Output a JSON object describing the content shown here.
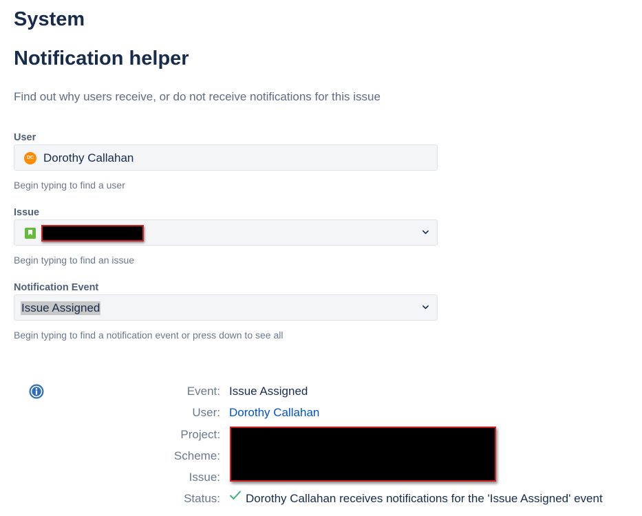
{
  "header": {
    "system_title": "System",
    "page_title": "Notification helper",
    "intro": "Find out why users receive, or do not receive notifications for this issue"
  },
  "form": {
    "user": {
      "label": "User",
      "avatar_initials": "DC",
      "value": "Dorothy Callahan",
      "hint": "Begin typing to find a user"
    },
    "issue": {
      "label": "Issue",
      "value_redacted": true,
      "hint": "Begin typing to find an issue"
    },
    "event": {
      "label": "Notification Event",
      "value": "Issue Assigned",
      "hint": "Begin typing to find a notification event or press down to see all"
    }
  },
  "result": {
    "event_label": "Event:",
    "event_value": "Issue Assigned",
    "user_label": "User:",
    "user_value": "Dorothy Callahan",
    "project_label": "Project:",
    "scheme_label": "Scheme:",
    "issue_label": "Issue:",
    "status_label": "Status:",
    "status_value": "Dorothy Callahan receives notifications for the 'Issue Assigned' event"
  },
  "colors": {
    "heading": "#172b4d",
    "link": "#0052cc",
    "success": "#36b37e",
    "info": "#0052cc",
    "avatar": "#ff8b00",
    "story": "#63ba3c",
    "redaction_border": "#d01f26"
  },
  "icons": [
    "avatar",
    "story-icon",
    "chevron-down-icon",
    "info-icon",
    "check-icon"
  ]
}
